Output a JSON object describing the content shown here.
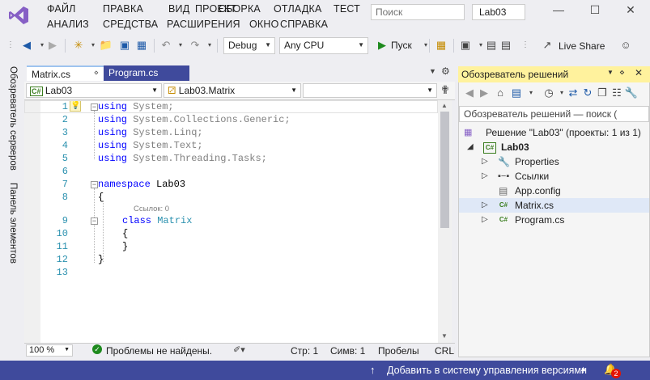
{
  "menu": [
    "ФАЙЛ",
    "ПРАВКА",
    "ВИД",
    "ПРОЕКТ",
    "СБОРКА",
    "ОТЛАДКА",
    "ТЕСТ",
    "АНАЛИЗ",
    "СРЕДСТВА",
    "РАСШИРЕНИЯ",
    "ОКНО",
    "СПРАВКА"
  ],
  "search": {
    "placeholder": "Поиск"
  },
  "project_title": "Lab03",
  "toolbar": {
    "config": "Debug",
    "platform": "Any CPU",
    "run_label": "Пуск",
    "live_share": "Live Share"
  },
  "sidetabs": [
    "Обозреватель серверов",
    "Панель элементов"
  ],
  "doc_tabs": [
    "Matrix.cs",
    "Program.cs"
  ],
  "nav": {
    "project": "Lab03",
    "type": "Lab03.Matrix",
    "member": ""
  },
  "code": {
    "line_numbers": [
      "1",
      "2",
      "3",
      "4",
      "5",
      "6",
      "7",
      "8",
      "",
      "9",
      "10",
      "11",
      "12",
      "13"
    ],
    "usings": [
      {
        "kw": "using",
        "rest": " System;"
      },
      {
        "kw": "using",
        "rest": " System.Collections.Generic;"
      },
      {
        "kw": "using",
        "rest": " System.Linq;"
      },
      {
        "kw": "using",
        "rest": " System.Text;"
      },
      {
        "kw": "using",
        "rest": " System.Threading.Tasks;"
      }
    ],
    "ns_kw": "namespace",
    "ns_name": " Lab03",
    "open_brace": "{",
    "close_brace": "}",
    "refs": "Ссылок: 0",
    "class_kw": "class",
    "class_name": " Matrix"
  },
  "editor_status": {
    "zoom": "100 %",
    "problems": "Проблемы не найдены.",
    "line": "Стр: 1",
    "col": "Симв: 1",
    "spaces": "Пробелы",
    "eol": "CRLF"
  },
  "solution_explorer": {
    "title": "Обозреватель решений",
    "search_placeholder": "Обозреватель решений — поиск (",
    "items": [
      {
        "label": "Решение \"Lab03\" (проекты: 1 из 1)"
      },
      {
        "label": "Lab03"
      },
      {
        "label": "Properties"
      },
      {
        "label": "Ссылки"
      },
      {
        "label": "App.config"
      },
      {
        "label": "Matrix.cs"
      },
      {
        "label": "Program.cs"
      }
    ]
  },
  "statusbar": {
    "source_control": "Добавить в систему управления версиями",
    "notifications": "2"
  },
  "colors": {
    "accent": "#3f4a9c",
    "se_header": "#fff29d",
    "keyword": "#0000ff",
    "type": "#2b91af"
  }
}
